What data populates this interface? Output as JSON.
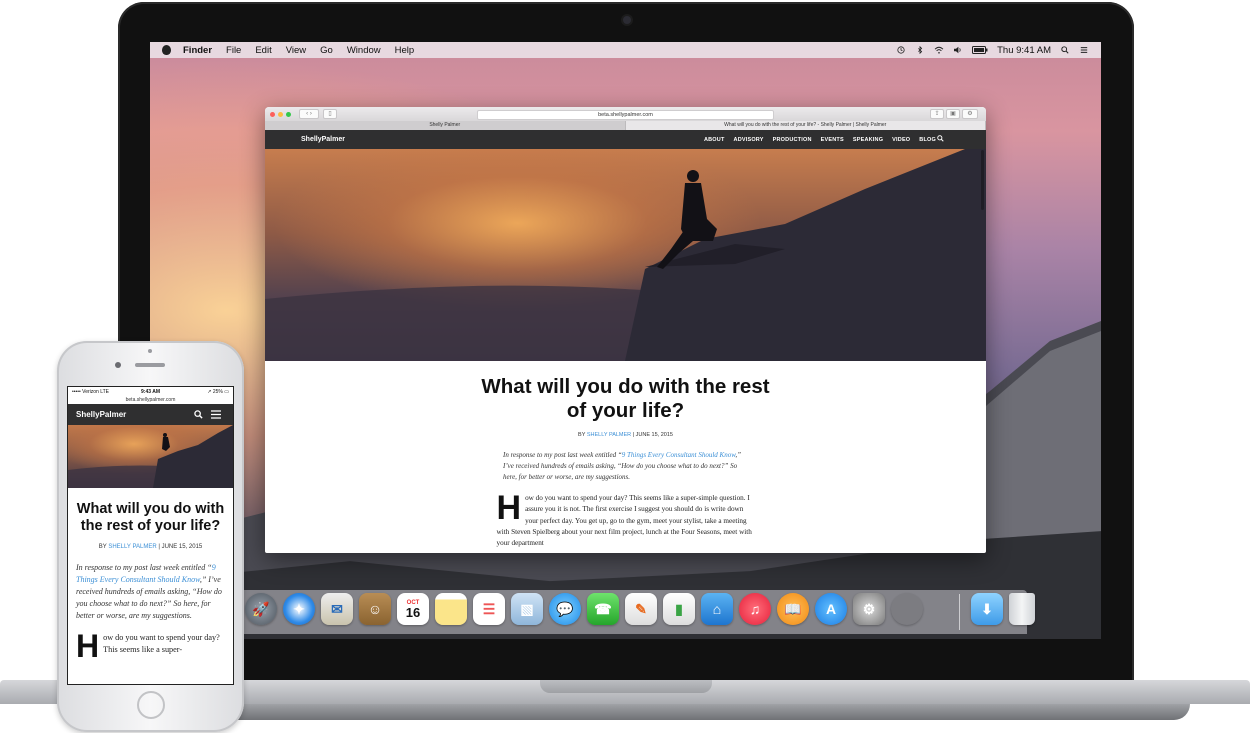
{
  "mac": {
    "menubar": {
      "app": "Finder",
      "items": [
        "File",
        "Edit",
        "View",
        "Go",
        "Window",
        "Help"
      ],
      "clock": "Thu 9:41 AM"
    },
    "safari": {
      "url": "beta.shellypalmer.com",
      "tabs": [
        "Shelly Palmer",
        "What will you do with the rest of your life? - Shelly Palmer | Shelly Palmer"
      ]
    },
    "site": {
      "logo": "ShellyPalmer",
      "menu": [
        "ABOUT",
        "ADVISORY",
        "PRODUCTION",
        "EVENTS",
        "SPEAKING",
        "VIDEO",
        "BLOG"
      ]
    },
    "article": {
      "title": "What will you do with the rest of your life?",
      "by_prefix": "BY",
      "author": "SHELLY PALMER",
      "date": "| JUNE 15, 2015",
      "intro_before": "In response to my post last week entitled “",
      "intro_link": "9 Things Every Consultant Should Know",
      "intro_after": ",” I’ve received hundreds of emails asking, “How do you choose what to do next?” So here, for better or worse, are my suggestions.",
      "dropcap": "H",
      "body": "ow do you want to spend your day? This seems like a super-simple question. I assure you it is not. The first exercise I suggest you should do is write down your perfect day. You get up, go to the gym, meet your stylist, take a meeting with Steven Spielberg about your next film project, lunch at the Four Seasons, meet with your department"
    },
    "dock": {
      "calendar_month": "OCT",
      "calendar_day": "16"
    }
  },
  "iphone": {
    "status": {
      "carrier": "••••• Verizon  LTE",
      "time": "9:43 AM",
      "battery": "↗ 25% ▭"
    },
    "url": "beta.shellypalmer.com",
    "logo": "ShellyPalmer",
    "article": {
      "title": "What will you do with the rest of your life?",
      "by_prefix": "BY",
      "author": "SHELLY PALMER",
      "date": "| JUNE 15, 2015",
      "intro_before": "In response to my post last week entitled “",
      "intro_link": "9 Things Every Consultant Should Know",
      "intro_after": ",” I’ve received hundreds of emails asking, “How do you choose what to do next?” So here, for better or worse, are my suggestions.",
      "dropcap": "H",
      "body": "ow do you want to spend your day? This seems like a super-"
    }
  }
}
